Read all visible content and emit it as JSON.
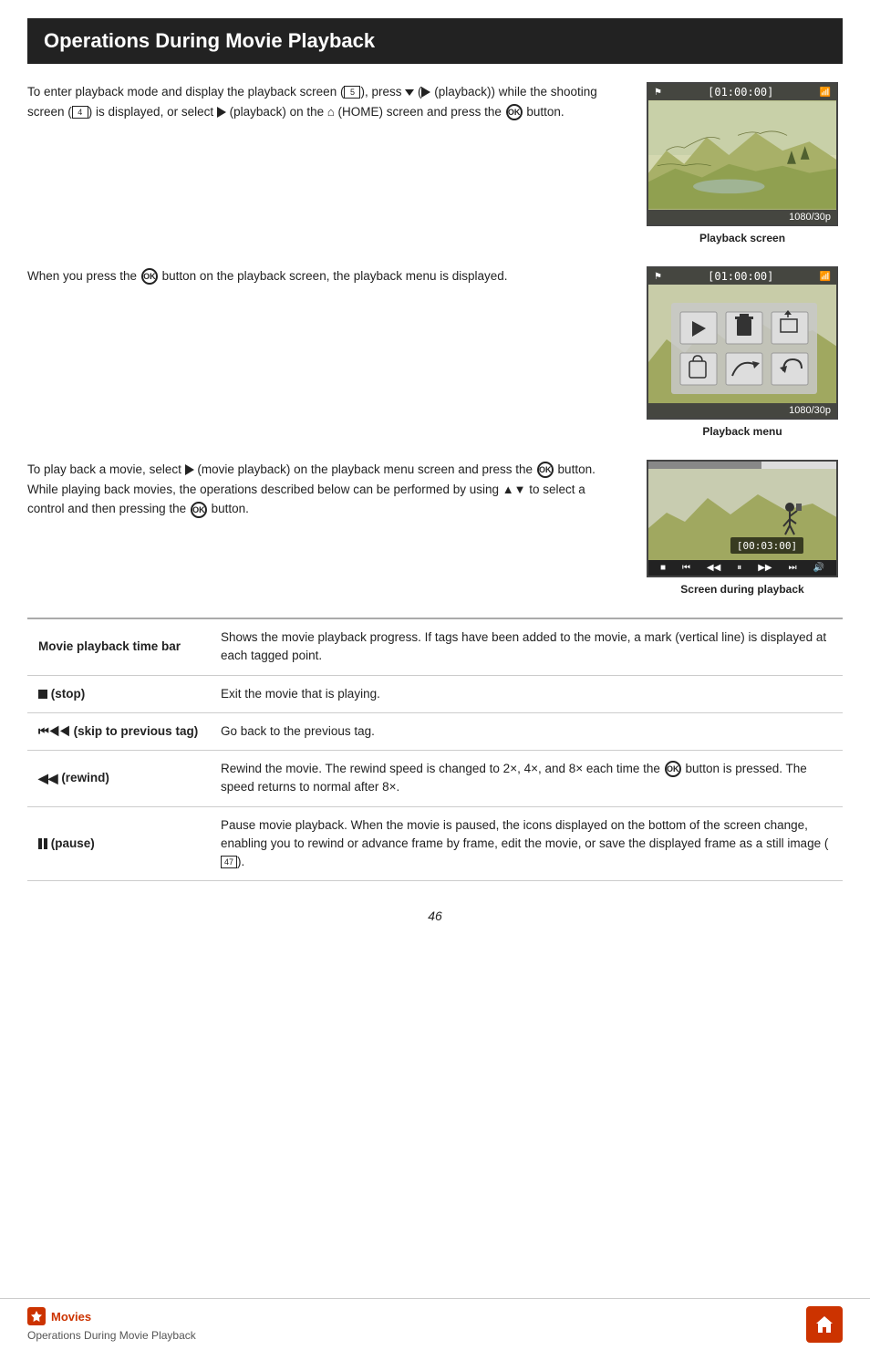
{
  "header": {
    "title": "Operations During Movie Playback"
  },
  "sections": [
    {
      "id": "section1",
      "text": "To enter playback mode and display the playback screen (□5), press ▼ (► (playback)) while the shooting screen (□4) is displayed, or select ► (playback) on the ⌂ (HOME) screen and press the ⒪ button.",
      "image_caption": "Playback screen",
      "screen_time": "[01:00:00]",
      "screen_res": "1080/30p"
    },
    {
      "id": "section2",
      "text": "When you press the ⒪ button on the playback screen, the playback menu is displayed.",
      "image_caption": "Playback menu",
      "screen_time": "[01:00:00]",
      "screen_res": "1080/30p"
    },
    {
      "id": "section3",
      "text": "To play back a movie, select ► (movie playback) on the playback menu screen and press the ⒪ button. While playing back movies, the operations described below can be performed by using ▲▼ to select a control and then pressing the ⒪ button.",
      "image_caption": "Screen during playback",
      "playback_time": "[00:03:00]"
    }
  ],
  "table": {
    "rows": [
      {
        "label": "Movie playback time bar",
        "description": "Shows the movie playback progress. If tags have been added to the movie, a mark (vertical line) is displayed at each tagged point."
      },
      {
        "label": "(stop)",
        "description": "Exit the movie that is playing."
      },
      {
        "label": "(skip to previous tag)",
        "description": "Go back to the previous tag."
      },
      {
        "label": "(rewind)",
        "description": "Rewind the movie. The rewind speed is changed to 2×, 4×, and 8× each time the ⒪ button is pressed. The speed returns to normal after 8×."
      },
      {
        "label": "(pause)",
        "description": "Pause movie playback. When the movie is paused, the icons displayed on the bottom of the screen change, enabling you to rewind or advance frame by frame, edit the movie, or save the displayed frame as a still image (□47)."
      }
    ]
  },
  "page_number": "46",
  "footer": {
    "category": "Movies",
    "breadcrumb": "Operations During Movie Playback",
    "home_title": "Home"
  }
}
